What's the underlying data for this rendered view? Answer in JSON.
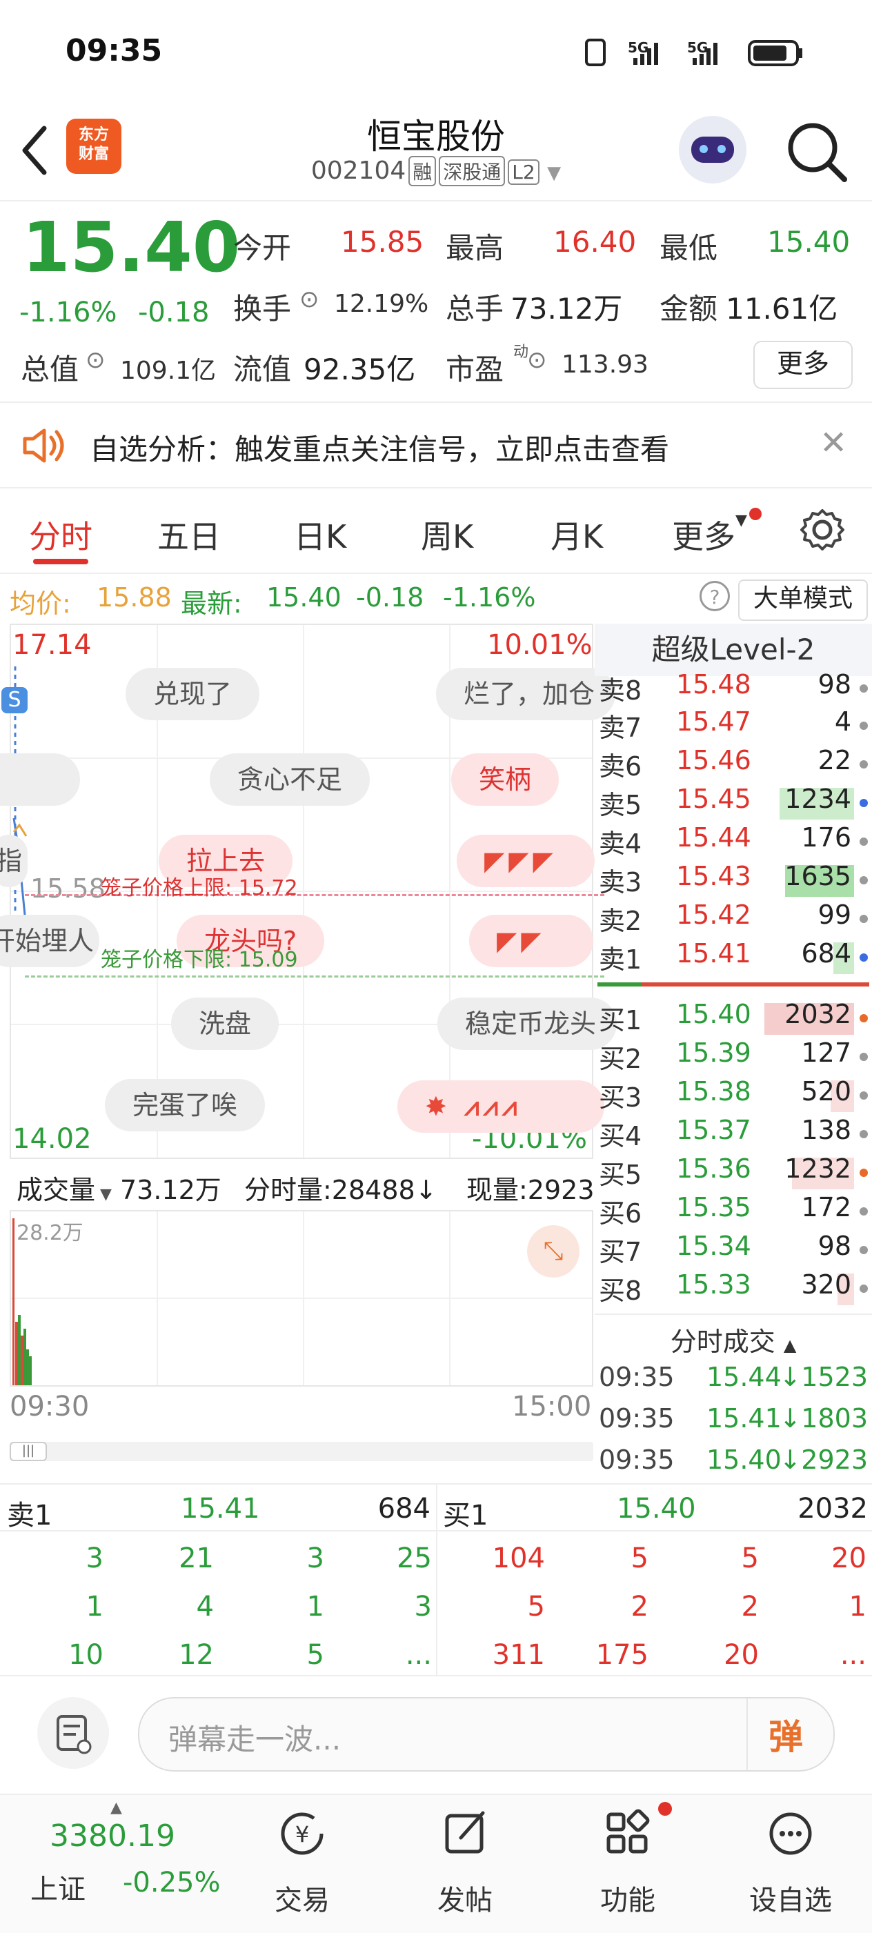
{
  "status_bar": {
    "time": "09:35",
    "network": "5G"
  },
  "header": {
    "logo_text_1": "东方",
    "logo_text_2": "财富",
    "title": "恒宝股份",
    "code": "002104",
    "tags": [
      "融",
      "深股通",
      "L2"
    ]
  },
  "quote": {
    "price": "15.40",
    "change_pct": "-1.16%",
    "change": "-0.18",
    "open_label": "今开",
    "open": "15.85",
    "high_label": "最高",
    "high": "16.40",
    "low_label": "最低",
    "low": "15.40",
    "turnover_label": "换手",
    "turnover": "12.19%",
    "total_hands_label": "总手",
    "total_hands": "73.12万",
    "amount_label": "金额",
    "amount": "11.61亿",
    "mktcap_label": "总值",
    "mktcap": "109.1亿",
    "float_label": "流值",
    "float": "92.35亿",
    "pe_label": "市盈",
    "pe_sup": "动",
    "pe": "113.93",
    "more_button": "更多"
  },
  "notice": {
    "text": "自选分析：触发重点关注信号，立即点击查看"
  },
  "tabs": [
    "分时",
    "五日",
    "日K",
    "周K",
    "月K",
    "更多"
  ],
  "chart_info": {
    "avg_label": "均价:",
    "avg": "15.88",
    "latest_label": "最新:",
    "latest": "15.40",
    "change": "-0.18",
    "change_pct": "-1.16%",
    "mode_button": "大单模式"
  },
  "chart": {
    "top_price": "17.14",
    "top_pct": "10.01%",
    "bottom_price": "14.02",
    "bottom_pct": "-10.01%",
    "mid_price": "15.58",
    "upper_limit": "笼子价格上限: 15.72",
    "lower_limit": "笼子价格下限: 15.09",
    "badge_s": "S",
    "badge_up": "涨",
    "partial_left_1": "指",
    "partial_left_2": "开始埋人",
    "bubbles": [
      "兑现了",
      "烂了，加仓",
      "贪心不足",
      "笑柄",
      "拉上去",
      "龙头吗?",
      "洗盘",
      "稳定币龙头",
      "完蛋了唉"
    ]
  },
  "level2": {
    "title": "超级Level-2",
    "asks": [
      {
        "label": "卖8",
        "price": "15.48",
        "vol": "98"
      },
      {
        "label": "卖7",
        "price": "15.47",
        "vol": "4"
      },
      {
        "label": "卖6",
        "price": "15.46",
        "vol": "22"
      },
      {
        "label": "卖5",
        "price": "15.45",
        "vol": "1234"
      },
      {
        "label": "卖4",
        "price": "15.44",
        "vol": "176"
      },
      {
        "label": "卖3",
        "price": "15.43",
        "vol": "1635"
      },
      {
        "label": "卖2",
        "price": "15.42",
        "vol": "99"
      },
      {
        "label": "卖1",
        "price": "15.41",
        "vol": "684"
      }
    ],
    "bids": [
      {
        "label": "买1",
        "price": "15.40",
        "vol": "2032"
      },
      {
        "label": "买2",
        "price": "15.39",
        "vol": "127"
      },
      {
        "label": "买3",
        "price": "15.38",
        "vol": "520"
      },
      {
        "label": "买4",
        "price": "15.37",
        "vol": "138"
      },
      {
        "label": "买5",
        "price": "15.36",
        "vol": "1232"
      },
      {
        "label": "买6",
        "price": "15.35",
        "vol": "172"
      },
      {
        "label": "买7",
        "price": "15.34",
        "vol": "98"
      },
      {
        "label": "买8",
        "price": "15.33",
        "vol": "320"
      }
    ],
    "trades_title": "分时成交",
    "trades": [
      {
        "time": "09:35",
        "price": "15.44",
        "vol": "↓1523"
      },
      {
        "time": "09:35",
        "price": "15.41",
        "vol": "↓1803"
      },
      {
        "time": "09:35",
        "price": "15.40",
        "vol": "↓2923"
      }
    ]
  },
  "volume": {
    "label": "成交量",
    "total": "73.12万",
    "min_vol": "分时量:28488↓",
    "cur_vol": "现量:2923",
    "max": "28.2万",
    "start_time": "09:30",
    "end_time": "15:00"
  },
  "bottom_grid": {
    "sell_label": "卖1",
    "sell_price": "15.41",
    "sell_vol": "684",
    "buy_label": "买1",
    "buy_price": "15.40",
    "buy_vol": "2032",
    "sell_rows": [
      [
        "3",
        "21",
        "3",
        "25"
      ],
      [
        "1",
        "4",
        "1",
        "3"
      ],
      [
        "10",
        "12",
        "5",
        "..."
      ]
    ],
    "buy_rows": [
      [
        "104",
        "5",
        "5",
        "20"
      ],
      [
        "5",
        "2",
        "2",
        "1"
      ],
      [
        "311",
        "175",
        "20",
        "..."
      ]
    ]
  },
  "comment": {
    "placeholder": "弹幕走一波...",
    "danmu_button": "弹"
  },
  "nav": {
    "index_value": "3380.19",
    "index_name": "上证",
    "index_change": "-0.25%",
    "items": [
      "交易",
      "发帖",
      "功能",
      "设自选"
    ]
  }
}
